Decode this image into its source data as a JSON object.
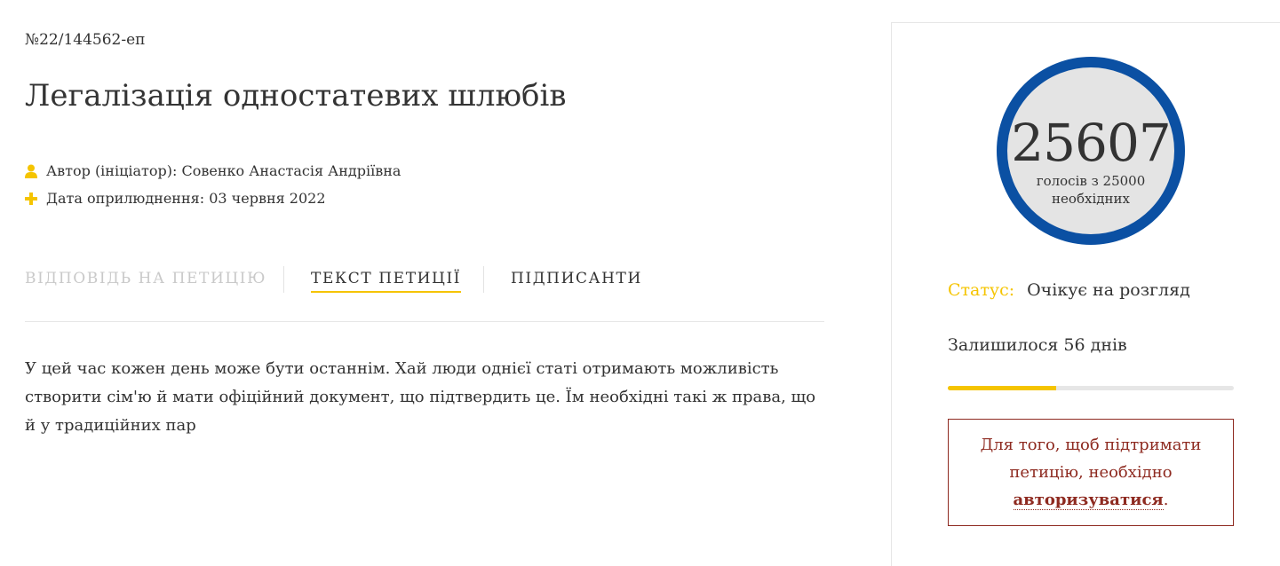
{
  "petition": {
    "number": "№22/144562-еп",
    "title": "Легалізація одностатевих шлюбів",
    "author_label": "Автор (ініціатор):",
    "author_name": "Совенко Анастасія Андріївна",
    "date_label": "Дата оприлюднення:",
    "date_value": "03 червня 2022",
    "text": "У цей час кожен день може бути останнім. Хай люди однієї статі отримають можливість створити сім'ю й мати офіційний документ, що підтвердить це. Їм необхідні такі ж права, що й у традиційних пар"
  },
  "tabs": [
    {
      "label": "Відповідь на петицію",
      "state": "disabled"
    },
    {
      "label": "Текст петиції",
      "state": "active"
    },
    {
      "label": "Підписанти",
      "state": "normal"
    }
  ],
  "sidebar": {
    "votes_count": "25607",
    "votes_caption": "голосів з 25000 необхідних",
    "status_label": "Статус:",
    "status_value": "Очікує на розгляд",
    "days_left": "Залишилося 56 днів",
    "progress_fraction": 0.38,
    "auth_text_before": "Для того, щоб підтримати петицію, необхідно",
    "auth_link": "авторизуватися",
    "auth_text_after": "."
  },
  "icons": {
    "author": "user-icon",
    "date": "plus-icon"
  },
  "colors": {
    "accent": "#f5c400",
    "circle_border": "#0b50a3",
    "auth": "#8e2a20",
    "text": "#333333"
  }
}
